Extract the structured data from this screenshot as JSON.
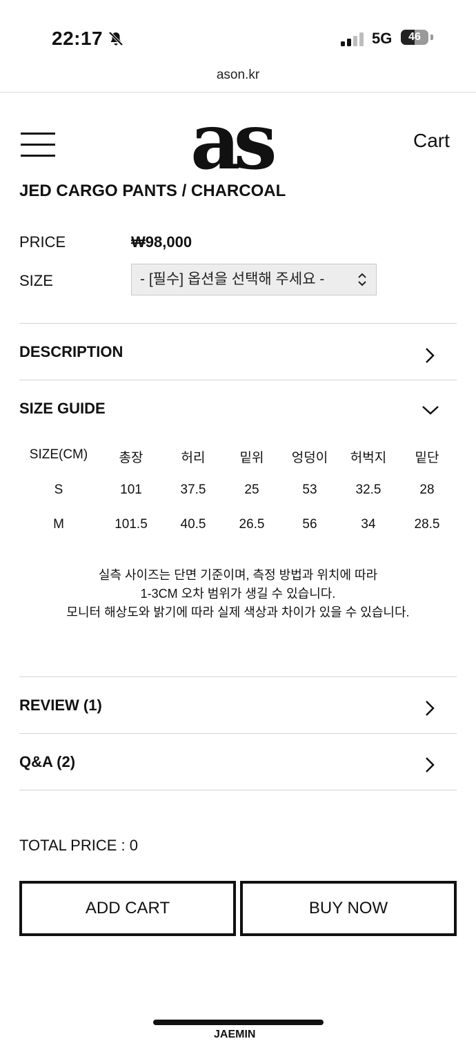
{
  "status_bar": {
    "time": "22:17",
    "network": "5G",
    "battery": "46"
  },
  "browser": {
    "url": "ason.kr"
  },
  "header": {
    "logo": "as",
    "cart_label": "Cart"
  },
  "product": {
    "title": "JED CARGO PANTS / CHARCOAL",
    "price_label": "PRICE",
    "price_value": "₩98,000",
    "size_label": "SIZE",
    "size_select": "- [필수] 옵션을 선택해 주세요 -"
  },
  "sections": {
    "description": "DESCRIPTION",
    "size_guide": "SIZE GUIDE",
    "review": "REVIEW (1)",
    "qna": "Q&A (2)"
  },
  "size_table": {
    "headers": [
      "SIZE(CM)",
      "총장",
      "허리",
      "밑위",
      "엉덩이",
      "허벅지",
      "밑단"
    ],
    "rows": [
      [
        "S",
        "101",
        "37.5",
        "25",
        "53",
        "32.5",
        "28"
      ],
      [
        "M",
        "101.5",
        "40.5",
        "26.5",
        "56",
        "34",
        "28.5"
      ]
    ]
  },
  "size_note": [
    "실측 사이즈는 단면 기준이며, 측정 방법과 위치에 따라",
    "1-3CM 오차 범위가 생길 수 있습니다.",
    "모니터 해상도와 밝기에 따라 실제 색상과 차이가 있을 수 있습니다."
  ],
  "total_price": "TOTAL PRICE : 0",
  "buttons": {
    "add_cart": "ADD CART",
    "buy_now": "BUY NOW"
  },
  "footer_partial": "JAEMIN"
}
